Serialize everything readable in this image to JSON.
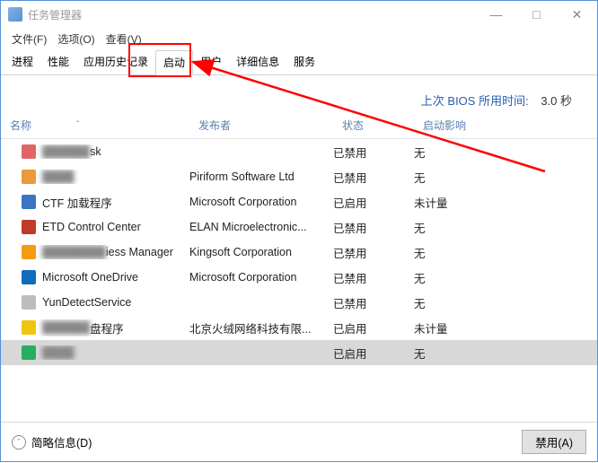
{
  "window": {
    "title": "任务管理器",
    "minimize": "—",
    "maximize": "□",
    "close": "✕"
  },
  "menu": {
    "file": "文件(F)",
    "options": "选项(O)",
    "view": "查看(V)"
  },
  "tabs": {
    "processes": "进程",
    "performance": "性能",
    "history": "应用历史记录",
    "startup": "启动",
    "users": "用户",
    "details": "详细信息",
    "services": "服务"
  },
  "bios": {
    "label": "上次 BIOS 所用时间:",
    "value": "3.0 秒"
  },
  "columns": {
    "name": "名称",
    "publisher": "发布者",
    "status": "状态",
    "impact": "启动影响"
  },
  "rows": [
    {
      "iconColor": "#e06666",
      "name_blur": "██████",
      "name_clear": "sk",
      "publisher": "",
      "status": "已禁用",
      "impact": "无"
    },
    {
      "iconColor": "#e89a3c",
      "name_blur": "████",
      "name_clear": "",
      "publisher": "Piriform Software Ltd",
      "status": "已禁用",
      "impact": "无"
    },
    {
      "iconColor": "#3a75c4",
      "name_blur": "",
      "name_clear": "CTF 加载程序",
      "publisher": "Microsoft Corporation",
      "status": "已启用",
      "impact": "未计量"
    },
    {
      "iconColor": "#c0392b",
      "name_blur": "",
      "name_clear": "ETD Control Center",
      "publisher": "ELAN Microelectronic...",
      "status": "已禁用",
      "impact": "无"
    },
    {
      "iconColor": "#f39c12",
      "name_blur": "████████",
      "name_clear": "iess Manager",
      "publisher": "Kingsoft Corporation",
      "status": "已禁用",
      "impact": "无"
    },
    {
      "iconColor": "#0f6cbd",
      "name_blur": "",
      "name_clear": "Microsoft OneDrive",
      "publisher": "Microsoft Corporation",
      "status": "已禁用",
      "impact": "无"
    },
    {
      "iconColor": "#bdbdbd",
      "name_blur": "",
      "name_clear": "YunDetectService",
      "publisher": "",
      "status": "已禁用",
      "impact": "无"
    },
    {
      "iconColor": "#f1c40f",
      "name_blur": "██████",
      "name_clear": "盘程序",
      "publisher": "北京火绒网络科技有限...",
      "status": "已启用",
      "impact": "未计量"
    },
    {
      "iconColor": "#27ae60",
      "name_blur": "████",
      "name_clear": "",
      "publisher": "",
      "status": "已启用",
      "impact": "无",
      "selected": true
    }
  ],
  "bottom": {
    "fewer": "简略信息(D)",
    "disable": "禁用(A)"
  }
}
